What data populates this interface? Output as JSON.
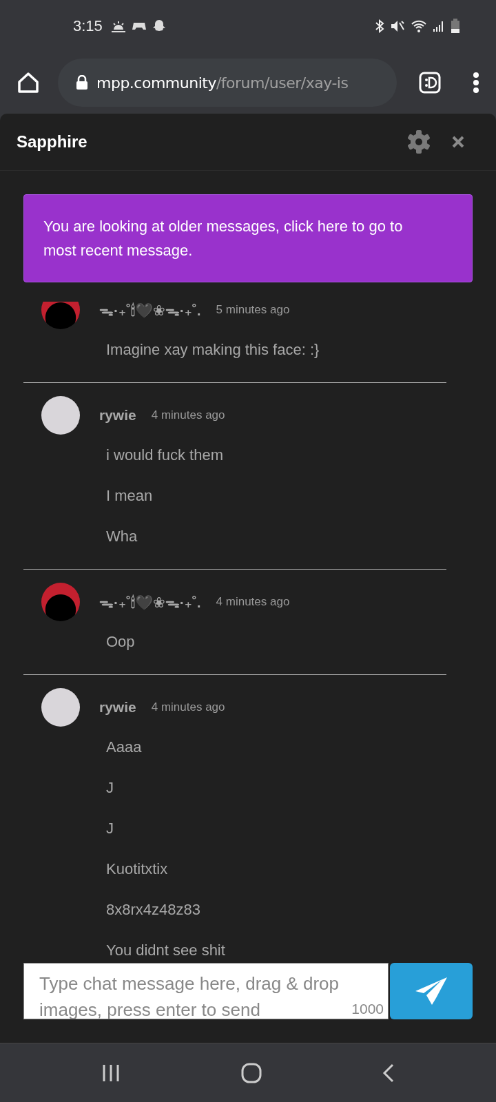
{
  "status_bar": {
    "time": "3:15"
  },
  "browser": {
    "url_host": "mpp.community",
    "url_path": "/forum/user/xay-is"
  },
  "chat": {
    "title": "Sapphire",
    "banner": "You are looking at older messages, click here to go to most recent message.",
    "messages": [
      {
        "author": "ᯓ·₊˚🕯🖤❀ᯓ·₊˚.",
        "kind": "dark",
        "time": "5 minutes ago",
        "lines": [
          "Imagine xay making this face: :}"
        ]
      },
      {
        "author": "rywie",
        "kind": "pale",
        "time": "4 minutes ago",
        "lines": [
          "i would fuck them",
          "I mean",
          "Wha"
        ]
      },
      {
        "author": "ᯓ·₊˚🕯🖤❀ᯓ·₊˚.",
        "kind": "dark",
        "time": "4 minutes ago",
        "lines": [
          "Oop"
        ]
      },
      {
        "author": "rywie",
        "kind": "pale",
        "time": "4 minutes ago",
        "lines": [
          "Aaaa",
          "J",
          "J",
          "Kuotitxtix",
          "8x8rx4z48z83",
          "You didnt see shit"
        ]
      }
    ],
    "input": {
      "placeholder": "Type chat message here, drag & drop images, press enter to send",
      "counter": "1000"
    }
  }
}
